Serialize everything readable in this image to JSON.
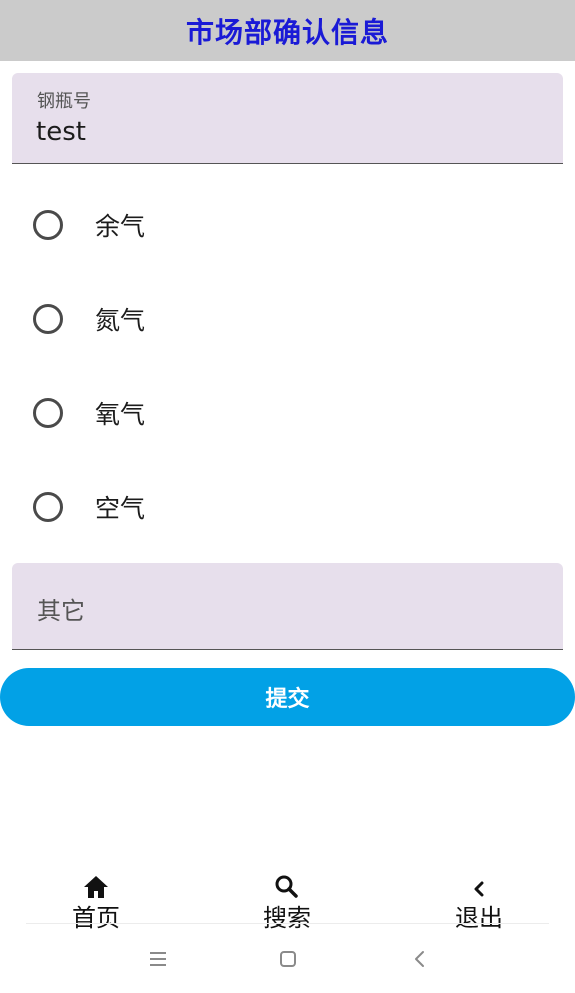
{
  "header": {
    "title": "市场部确认信息"
  },
  "cylinder_field": {
    "label": "钢瓶号",
    "value": "test"
  },
  "gas_options": [
    {
      "label": "余气",
      "selected": false
    },
    {
      "label": "氮气",
      "selected": false
    },
    {
      "label": "氧气",
      "selected": false
    },
    {
      "label": "空气",
      "selected": false
    }
  ],
  "other_field": {
    "placeholder": "其它",
    "value": ""
  },
  "submit": {
    "label": "提交"
  },
  "bottom_nav": [
    {
      "label": "首页",
      "icon": "home-icon"
    },
    {
      "label": "搜索",
      "icon": "search-icon"
    },
    {
      "label": "退出",
      "icon": "back-icon"
    }
  ],
  "system_nav": [
    {
      "icon": "menu-icon"
    },
    {
      "icon": "home-square-icon"
    },
    {
      "icon": "back-arrow-icon"
    }
  ],
  "colors": {
    "title_bar_bg": "#cbcbcb",
    "title_text": "#1a1ad6",
    "field_bg": "#e7dfec",
    "submit_bg": "#02a1e6"
  }
}
